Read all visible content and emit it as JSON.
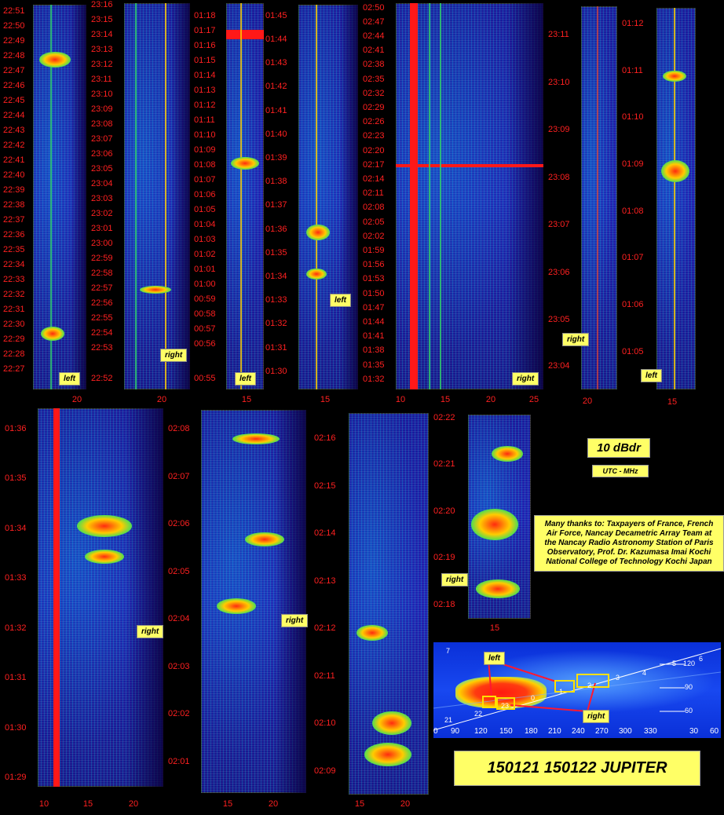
{
  "panels": [
    {
      "times": [
        "22:51",
        "22:50",
        "22:49",
        "22:48",
        "22:47",
        "22:46",
        "22:45",
        "22:44",
        "22:43",
        "22:42",
        "22:41",
        "22:40",
        "22:39",
        "22:38",
        "22:37",
        "22:36",
        "22:35",
        "22:34",
        "22:33",
        "22:32",
        "22:31",
        "22:30",
        "22:29",
        "22:28",
        "22:27"
      ],
      "xticks": [
        "20"
      ],
      "tag": "left"
    },
    {
      "times": [
        "23:16",
        "23:15",
        "23:14",
        "23:13",
        "23:12",
        "23:11",
        "23:10",
        "23:09",
        "23:08",
        "23:07",
        "23:06",
        "23:05",
        "23:04",
        "23:03",
        "23:02",
        "23:01",
        "23:00",
        "22:59",
        "22:58",
        "22:57",
        "22:56",
        "22:55",
        "22:54",
        "22:53",
        "22:52"
      ],
      "xticks": [
        "20"
      ],
      "tag": "right"
    },
    {
      "times": [
        "01:18",
        "01:17",
        "01:16",
        "01:15",
        "01:14",
        "01:13",
        "01:12",
        "01:11",
        "01:10",
        "01:09",
        "01:08",
        "01:07",
        "01:06",
        "01:05",
        "01:04",
        "01:03",
        "01:02",
        "01:01",
        "01:00",
        "00:59",
        "00:58",
        "00:57",
        "00:56",
        "00:55"
      ],
      "xticks": [
        "15"
      ],
      "tag": "left"
    },
    {
      "times": [
        "01:45",
        "01:44",
        "01:43",
        "01:42",
        "01:41",
        "01:40",
        "01:39",
        "01:38",
        "01:37",
        "01:36",
        "01:35",
        "01:34",
        "01:33",
        "01:32",
        "01:31",
        "01:30"
      ],
      "xticks": [
        "15"
      ],
      "tag": "left"
    },
    {
      "times": [
        "02:50",
        "02:47",
        "02:44",
        "02:41",
        "02:38",
        "02:35",
        "02:32",
        "02:29",
        "02:26",
        "02:23",
        "02:20",
        "02:17",
        "02:14",
        "02:11",
        "02:08",
        "02:05",
        "02:02",
        "01:59",
        "01:56",
        "01:53",
        "01:50",
        "01:47",
        "01:44",
        "01:41",
        "01:38",
        "01:35",
        "01:32"
      ],
      "xticks": [
        "10",
        "15",
        "20",
        "25"
      ],
      "tag": "right"
    },
    {
      "times": [
        "23:11",
        "23:10",
        "23:09",
        "23:08",
        "23:07",
        "23:06",
        "23:05",
        "23:04"
      ],
      "xticks": [
        "20"
      ],
      "tag": "right"
    },
    {
      "times": [
        "01:12",
        "01:11",
        "01:10",
        "01:09",
        "01:08",
        "01:07",
        "01:06",
        "01:05"
      ],
      "xticks": [
        "15"
      ],
      "tag": "left"
    },
    {
      "times": [
        "01:36",
        "01:35",
        "01:34",
        "01:33",
        "01:32",
        "01:31",
        "01:30",
        "01:29"
      ],
      "xticks": [
        "10",
        "15",
        "20"
      ],
      "tag": "right"
    },
    {
      "times": [
        "02:08",
        "02:07",
        "02:06",
        "02:05",
        "02:04",
        "02:03",
        "02:02",
        "02:01"
      ],
      "xticks": [
        "15",
        "20"
      ],
      "tag": "right"
    },
    {
      "times": [
        "02:16",
        "02:15",
        "02:14",
        "02:13",
        "02:12",
        "02:11",
        "02:10",
        "02:09"
      ],
      "xticks": [
        "15",
        "20"
      ],
      "tag": ""
    },
    {
      "times": [
        "02:22",
        "02:21",
        "02:20",
        "02:19",
        "02:18"
      ],
      "xticks": [
        "15"
      ],
      "tag": "right"
    }
  ],
  "legend": {
    "scale": "10 dBdr",
    "units": "UTC - MHz",
    "thanks": "Many thanks to: Taxpayers of France, French Air Force, Nancay Decametric Array Team at the Nancay Radio Astronomy Station of Paris Observatory, Prof. Dr. Kazumasa Imai Kochi National College of Technology Kochi Japan",
    "title": "150121 150122 JUPITER"
  },
  "map": {
    "xticks": [
      "0",
      "90",
      "120",
      "150",
      "180",
      "210",
      "240",
      "270",
      "300",
      "330",
      "30",
      "60"
    ],
    "yticks": [
      "120",
      "90",
      "60"
    ],
    "track_numbers": [
      "7",
      "6",
      "5",
      "4",
      "3",
      "2",
      "1",
      "0",
      "23",
      "22",
      "21"
    ],
    "tag_left": "left",
    "tag_right": "right"
  },
  "colors": {
    "axis_text": "#ff2020",
    "tag_bg": "#ffff66",
    "background": "#000000"
  }
}
